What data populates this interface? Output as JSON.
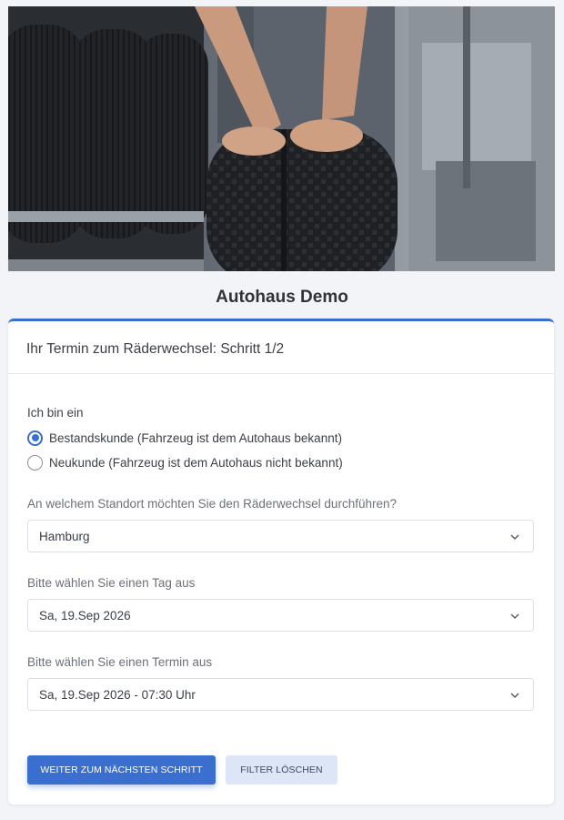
{
  "hero": {
    "alt_icon": "tire-change-photo"
  },
  "brand": {
    "title": "Autohaus Demo"
  },
  "card": {
    "header": "Ihr Termin zum Räderwechsel: Schritt 1/2"
  },
  "customer_type": {
    "label": "Ich bin ein",
    "options": [
      {
        "label": "Bestandskunde (Fahrzeug ist dem Autohaus bekannt)",
        "checked": true
      },
      {
        "label": "Neukunde (Fahrzeug ist dem Autohaus nicht bekannt)",
        "checked": false
      }
    ]
  },
  "location": {
    "label": "An welchem Standort möchten Sie den Räderwechsel durchführen?",
    "value": "Hamburg"
  },
  "day": {
    "label": "Bitte wählen Sie einen Tag aus",
    "value": "Sa, 19.Sep 2026"
  },
  "slot": {
    "label": "Bitte wählen Sie einen Termin aus",
    "value": "Sa, 19.Sep 2026 - 07:30 Uhr"
  },
  "actions": {
    "next_label": "WEITER ZUM NÄCHSTEN SCHRITT",
    "clear_label": "FILTER LÖSCHEN"
  },
  "colors": {
    "accent": "#3a6fd0",
    "secondary_button": "#dde6f6",
    "background": "#f3f4f8"
  }
}
